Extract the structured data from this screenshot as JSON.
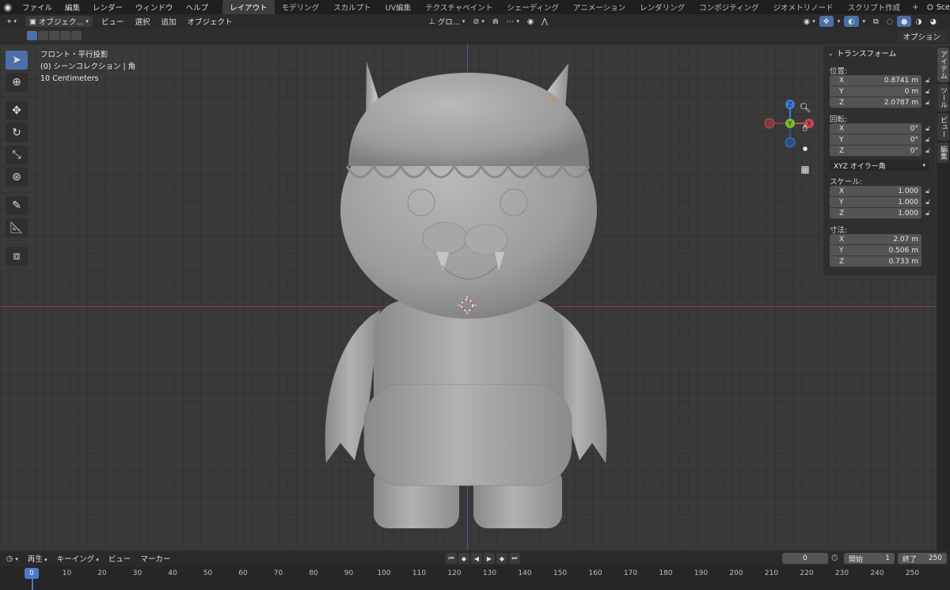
{
  "topbar": {
    "menus": [
      "ファイル",
      "編集",
      "レンダー",
      "ウィンドウ",
      "ヘルプ"
    ],
    "workspaces": [
      "レイアウト",
      "モデリング",
      "スカルプト",
      "UV編集",
      "テクスチャペイント",
      "シェーディング",
      "アニメーション",
      "レンダリング",
      "コンポジティング",
      "ジオメトリノード",
      "スクリプト作成"
    ],
    "active_workspace": "レイアウト",
    "add_tab": "+",
    "scene_label": "Sce"
  },
  "header": {
    "mode": "オブジェク...",
    "menus": [
      "ビュー",
      "選択",
      "追加",
      "オブジェクト"
    ],
    "orientation": "グロ..."
  },
  "header2": {
    "options": "オプション"
  },
  "viewport": {
    "view_name": "フロント・平行投影",
    "collection": "(0) シーンコレクション | 角",
    "scale": "10 Centimeters"
  },
  "gizmo": {
    "x": "X",
    "y": "Y",
    "z": "Z"
  },
  "npanel": {
    "title": "トランスフォーム",
    "location_label": "位置:",
    "location": [
      {
        "axis": "X",
        "value": "0.8741 m"
      },
      {
        "axis": "Y",
        "value": "0 m"
      },
      {
        "axis": "Z",
        "value": "2.0787 m"
      }
    ],
    "rotation_label": "回転:",
    "rotation": [
      {
        "axis": "X",
        "value": "0°"
      },
      {
        "axis": "Y",
        "value": "0°"
      },
      {
        "axis": "Z",
        "value": "0°"
      }
    ],
    "rotation_mode": "XYZ オイラー角",
    "scale_label": "スケール:",
    "scale": [
      {
        "axis": "X",
        "value": "1.000"
      },
      {
        "axis": "Y",
        "value": "1.000"
      },
      {
        "axis": "Z",
        "value": "1.000"
      }
    ],
    "dimensions_label": "寸法:",
    "dimensions": [
      {
        "axis": "X",
        "value": "2.07 m"
      },
      {
        "axis": "Y",
        "value": "0.506 m"
      },
      {
        "axis": "Z",
        "value": "0.733 m"
      }
    ]
  },
  "sidetabs": [
    "アイテム",
    "ツール",
    "ビュー",
    "編集"
  ],
  "timeline": {
    "menus": [
      "再生",
      "キーイング",
      "ビュー",
      "マーカー"
    ],
    "current_frame": "0",
    "start_label": "開始",
    "start": "1",
    "end_label": "終了",
    "end": "250",
    "ruler_ticks": [
      "10",
      "20",
      "30",
      "40",
      "50",
      "60",
      "70",
      "80",
      "90",
      "100",
      "110",
      "120",
      "130",
      "140",
      "150",
      "160",
      "170",
      "180",
      "190",
      "200",
      "210",
      "220",
      "230",
      "240",
      "250"
    ],
    "current_marker": "0"
  },
  "colors": {
    "accent_blue": "#4b6fa8",
    "axis_x_red": "#c8474f",
    "axis_y_green": "#7fb832",
    "axis_z_blue": "#3b7bd6"
  }
}
